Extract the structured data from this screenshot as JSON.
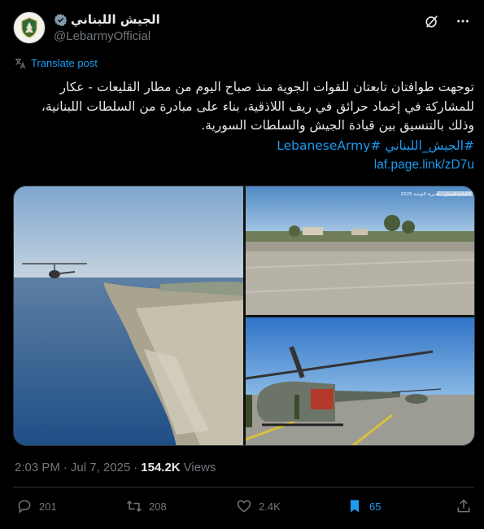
{
  "author": {
    "display_name": "الجيش اللبناني",
    "handle": "@LebarmyOfficial",
    "avatar_icon": "lebanese-army-emblem-icon",
    "verified_color": "#829aab"
  },
  "header_icons": [
    "grok-icon",
    "more-icon"
  ],
  "translate_label": "Translate post",
  "tweet": {
    "lines": [
      "توجهت طوافتان تابعتان للقوات الجوية منذ صباح اليوم من مطار القليعات - عكار",
      "للمشاركة في إخماد حرائق في ريف اللاذقية، بناء على مبادرة من السلطات اللبنانية،",
      "وذلك بالتنسيق بين قيادة الجيش والسلطات السورية."
    ],
    "hashtags": "#الجيش_اللبناني #LebaneseArmy",
    "link": "laf.page.link/zD7u"
  },
  "media": {
    "watermark": "قيادة الجيش - مديرية التوجيه 2025©"
  },
  "meta": {
    "time": "2:03 PM",
    "separator": "·",
    "date": "Jul 7, 2025",
    "views_count": "154.2K",
    "views_label": "Views"
  },
  "actions": {
    "replies": "201",
    "reposts": "208",
    "likes": "2.4K",
    "bookmarks": "65"
  },
  "colors": {
    "accent": "#1d9bf0",
    "muted": "#71767b",
    "text": "#e7e9ea",
    "background": "#000000"
  }
}
